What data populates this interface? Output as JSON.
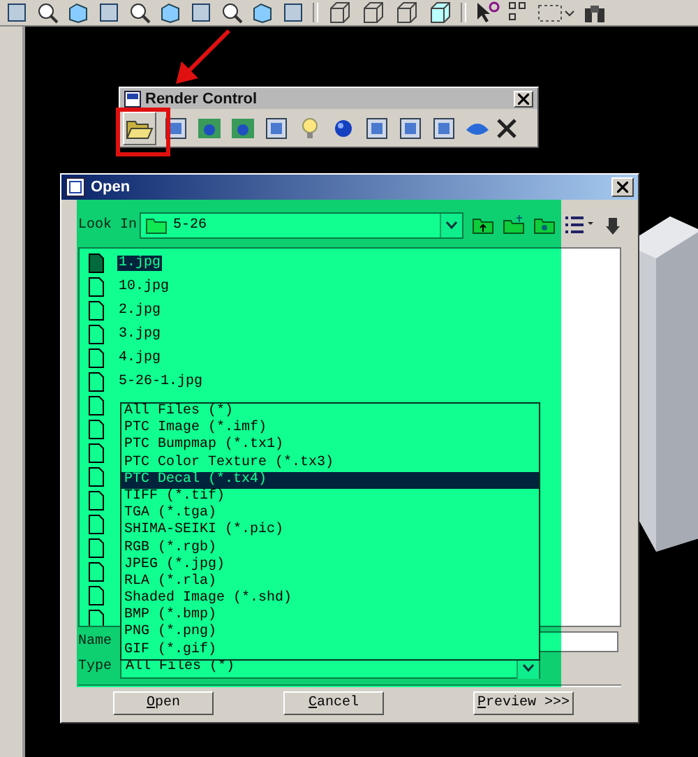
{
  "render_control": {
    "title": "Render Control"
  },
  "open_dialog": {
    "title": "Open",
    "look_in_label": "Look In",
    "look_in_value": "5-26",
    "files": [
      {
        "name": "1.jpg",
        "selected": true
      },
      {
        "name": "10.jpg",
        "selected": false
      },
      {
        "name": "2.jpg",
        "selected": false
      },
      {
        "name": "3.jpg",
        "selected": false
      },
      {
        "name": "4.jpg",
        "selected": false
      },
      {
        "name": "5-26-1.jpg",
        "selected": false
      }
    ],
    "name_label": "Name",
    "type_label": "Type",
    "type_value": "All Files (*)",
    "type_options": [
      {
        "label": "All Files (*)",
        "selected": false
      },
      {
        "label": "PTC Image (*.imf)",
        "selected": false
      },
      {
        "label": "PTC Bumpmap (*.tx1)",
        "selected": false
      },
      {
        "label": "PTC Color Texture (*.tx3)",
        "selected": false
      },
      {
        "label": "PTC Decal (*.tx4)",
        "selected": true
      },
      {
        "label": "TIFF (*.tif)",
        "selected": false
      },
      {
        "label": "TGA (*.tga)",
        "selected": false
      },
      {
        "label": "SHIMA-SEIKI (*.pic)",
        "selected": false
      },
      {
        "label": "RGB (*.rgb)",
        "selected": false
      },
      {
        "label": "JPEG (*.jpg)",
        "selected": false
      },
      {
        "label": "RLA (*.rla)",
        "selected": false
      },
      {
        "label": "Shaded Image (*.shd)",
        "selected": false
      },
      {
        "label": "BMP (*.bmp)",
        "selected": false
      },
      {
        "label": "PNG (*.png)",
        "selected": false
      },
      {
        "label": "GIF (*.gif)",
        "selected": false
      }
    ],
    "buttons": [
      {
        "key": "O",
        "rest": "pen"
      },
      {
        "key": "C",
        "rest": "ancel"
      },
      {
        "key": "P",
        "rest": "review >>>"
      }
    ]
  }
}
